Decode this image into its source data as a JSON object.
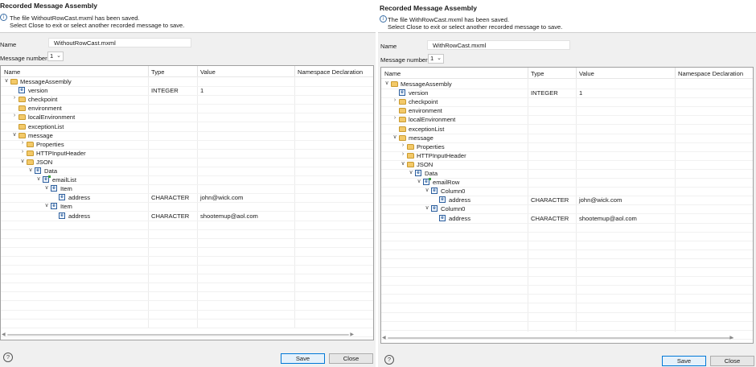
{
  "dialogs": [
    {
      "title": "Recorded Message Assembly",
      "info_line1": "The file WithoutRowCast.mxml has been saved.",
      "info_line2": "Select Close to exit or select another recorded message to save.",
      "name_label": "Name",
      "name_value": "WithoutRowCast.mxml",
      "message_number_label": "Message number",
      "message_number_value": "1",
      "columns": [
        "Name",
        "Type",
        "Value",
        "Namespace Declaration"
      ],
      "rows": [
        {
          "depth": 0,
          "toggle": "open",
          "icon": "folder",
          "name": "MessageAssembly",
          "type": "",
          "value": ""
        },
        {
          "depth": 1,
          "toggle": "",
          "icon": "element",
          "name": "version",
          "type": "INTEGER",
          "value": "1"
        },
        {
          "depth": 1,
          "toggle": "closed",
          "icon": "folder",
          "name": "checkpoint",
          "type": "",
          "value": ""
        },
        {
          "depth": 1,
          "toggle": "",
          "icon": "folder",
          "name": "environment",
          "type": "",
          "value": ""
        },
        {
          "depth": 1,
          "toggle": "closed",
          "icon": "folder",
          "name": "localEnvironment",
          "type": "",
          "value": ""
        },
        {
          "depth": 1,
          "toggle": "",
          "icon": "folder",
          "name": "exceptionList",
          "type": "",
          "value": ""
        },
        {
          "depth": 1,
          "toggle": "open",
          "icon": "folder",
          "name": "message",
          "type": "",
          "value": ""
        },
        {
          "depth": 2,
          "toggle": "closed",
          "icon": "folder",
          "name": "Properties",
          "type": "",
          "value": ""
        },
        {
          "depth": 2,
          "toggle": "closed",
          "icon": "folder",
          "name": "HTTPInputHeader",
          "type": "",
          "value": ""
        },
        {
          "depth": 2,
          "toggle": "open",
          "icon": "folder",
          "name": "JSON",
          "type": "",
          "value": ""
        },
        {
          "depth": 3,
          "toggle": "open",
          "icon": "element",
          "name": "Data",
          "type": "",
          "value": ""
        },
        {
          "depth": 4,
          "toggle": "open",
          "icon": "element-array",
          "name": "emailList",
          "type": "",
          "value": ""
        },
        {
          "depth": 5,
          "toggle": "open",
          "icon": "element",
          "name": "Item",
          "type": "",
          "value": ""
        },
        {
          "depth": 6,
          "toggle": "",
          "icon": "element",
          "name": "address",
          "type": "CHARACTER",
          "value": "john@wick.com"
        },
        {
          "depth": 5,
          "toggle": "open",
          "icon": "element",
          "name": "Item",
          "type": "",
          "value": ""
        },
        {
          "depth": 6,
          "toggle": "",
          "icon": "element",
          "name": "address",
          "type": "CHARACTER",
          "value": "shootemup@aol.com"
        }
      ],
      "help_symbol": "?",
      "save_label": "Save",
      "close_label": "Close"
    },
    {
      "title": "Recorded Message Assembly",
      "info_line1": "The file WithRowCast.mxml has been saved.",
      "info_line2": "Select Close to exit or select another recorded message to save.",
      "name_label": "Name",
      "name_value": "WithRowCast.mxml",
      "message_number_label": "Message number",
      "message_number_value": "1",
      "columns": [
        "Name",
        "Type",
        "Value",
        "Namespace Declaration"
      ],
      "rows": [
        {
          "depth": 0,
          "toggle": "open",
          "icon": "folder",
          "name": "MessageAssembly",
          "type": "",
          "value": ""
        },
        {
          "depth": 1,
          "toggle": "",
          "icon": "element",
          "name": "version",
          "type": "INTEGER",
          "value": "1"
        },
        {
          "depth": 1,
          "toggle": "closed",
          "icon": "folder",
          "name": "checkpoint",
          "type": "",
          "value": ""
        },
        {
          "depth": 1,
          "toggle": "",
          "icon": "folder",
          "name": "environment",
          "type": "",
          "value": ""
        },
        {
          "depth": 1,
          "toggle": "closed",
          "icon": "folder",
          "name": "localEnvironment",
          "type": "",
          "value": ""
        },
        {
          "depth": 1,
          "toggle": "",
          "icon": "folder",
          "name": "exceptionList",
          "type": "",
          "value": ""
        },
        {
          "depth": 1,
          "toggle": "open",
          "icon": "folder",
          "name": "message",
          "type": "",
          "value": ""
        },
        {
          "depth": 2,
          "toggle": "closed",
          "icon": "folder",
          "name": "Properties",
          "type": "",
          "value": ""
        },
        {
          "depth": 2,
          "toggle": "closed",
          "icon": "folder",
          "name": "HTTPInputHeader",
          "type": "",
          "value": ""
        },
        {
          "depth": 2,
          "toggle": "open",
          "icon": "folder",
          "name": "JSON",
          "type": "",
          "value": ""
        },
        {
          "depth": 3,
          "toggle": "open",
          "icon": "element",
          "name": "Data",
          "type": "",
          "value": ""
        },
        {
          "depth": 4,
          "toggle": "open",
          "icon": "element-array",
          "name": "emailRow",
          "type": "",
          "value": ""
        },
        {
          "depth": 5,
          "toggle": "open",
          "icon": "element",
          "name": "Column0",
          "type": "",
          "value": ""
        },
        {
          "depth": 6,
          "toggle": "",
          "icon": "element",
          "name": "address",
          "type": "CHARACTER",
          "value": "john@wick.com"
        },
        {
          "depth": 5,
          "toggle": "open",
          "icon": "element",
          "name": "Column0",
          "type": "",
          "value": ""
        },
        {
          "depth": 6,
          "toggle": "",
          "icon": "element",
          "name": "address",
          "type": "CHARACTER",
          "value": "shootemup@aol.com"
        }
      ],
      "help_symbol": "?",
      "save_label": "Save",
      "close_label": "Close"
    }
  ]
}
